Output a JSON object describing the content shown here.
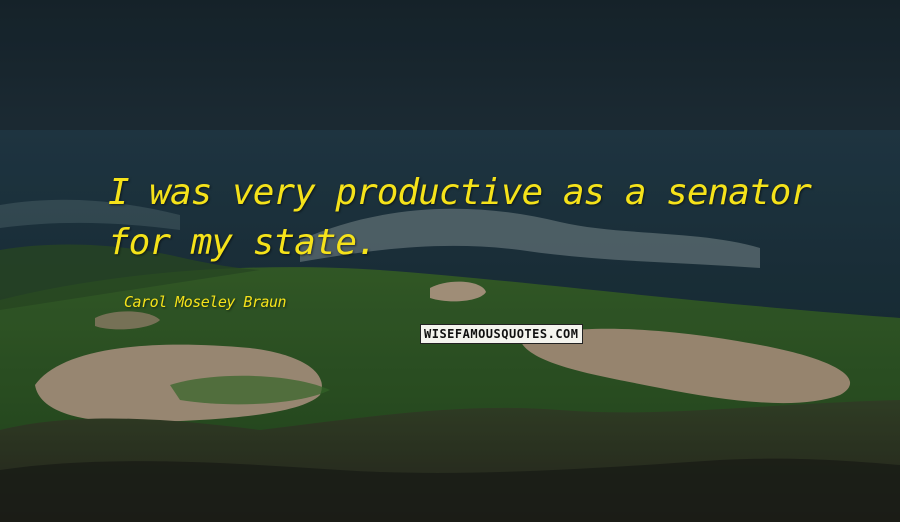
{
  "quote": {
    "text": "I was very productive as a senator for my state.",
    "author": "Carol Moseley Braun"
  },
  "watermark": {
    "text": "WISEFAMOUSQUOTES.COM"
  },
  "colors": {
    "quote_text": "#f5e21a",
    "sky": "#1b2c37",
    "sea": "#1f3d4c",
    "grass": "#2f5a2a",
    "sand": "#b9a48a",
    "watermark_bg": "#f4f4ee"
  }
}
